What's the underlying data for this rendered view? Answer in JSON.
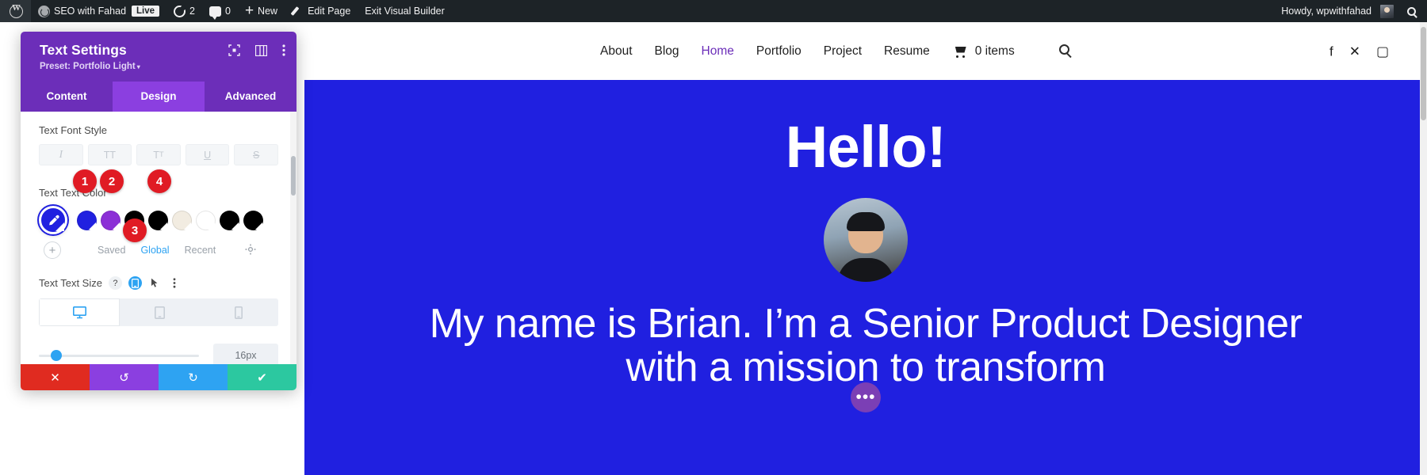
{
  "adminbar": {
    "logo_icon": "wordpress-logo-icon",
    "site_icon": "site-dashboard-icon",
    "site_name": "SEO with Fahad",
    "live_badge": "Live",
    "updates_icon": "updates-icon",
    "updates_count": "2",
    "comments_icon": "comments-icon",
    "comments_count": "0",
    "new_icon": "plus-icon",
    "new_label": "New",
    "edit_icon": "pencil-icon",
    "edit_label": "Edit Page",
    "exit_label": "Exit Visual Builder",
    "howdy": "Howdy, wpwithfahad",
    "avatar_icon": "user-avatar",
    "search_icon": "search-icon"
  },
  "site_header": {
    "nav": [
      {
        "label": "About",
        "active": false
      },
      {
        "label": "Blog",
        "active": false
      },
      {
        "label": "Home",
        "active": true
      },
      {
        "label": "Portfolio",
        "active": false
      },
      {
        "label": "Project",
        "active": false
      },
      {
        "label": "Resume",
        "active": false
      }
    ],
    "cart_icon": "shopping-cart-icon",
    "cart_label": "0 items",
    "search_icon": "search-icon",
    "social": [
      {
        "icon": "facebook-icon",
        "glyph": "f"
      },
      {
        "icon": "x-twitter-icon",
        "glyph": "✕"
      },
      {
        "icon": "instagram-icon",
        "glyph": "▢"
      }
    ]
  },
  "hero": {
    "background_color": "#2020e0",
    "heading": "Hello!",
    "avatar_icon": "profile-photo",
    "tagline": "My name is Brian. I’m a Senior Product Designer with a mission to transform",
    "more_button_icon": "ellipsis-icon",
    "more_button_label": "•••"
  },
  "modal": {
    "title": "Text Settings",
    "preset_label": "Preset: Portfolio Light",
    "preset_caret": "▾",
    "header_icons": [
      {
        "name": "focus-target-icon"
      },
      {
        "name": "layout-columns-icon"
      },
      {
        "name": "more-vertical-icon"
      }
    ],
    "tabs": [
      {
        "label": "Content",
        "active": false
      },
      {
        "label": "Design",
        "active": true
      },
      {
        "label": "Advanced",
        "active": false
      }
    ],
    "font_style": {
      "label": "Text Font Style",
      "buttons": [
        {
          "name": "italic-button",
          "glyph": "I"
        },
        {
          "name": "uppercase-button",
          "glyph": "TT"
        },
        {
          "name": "capitalize-button",
          "glyph": "T"
        },
        {
          "name": "underline-button",
          "glyph": "U"
        },
        {
          "name": "strikethrough-button",
          "glyph": "S"
        }
      ]
    },
    "text_color": {
      "label": "Text Text Color",
      "eyedropper_icon": "eyedropper-icon",
      "eyedropper_color": "#2020e0",
      "swatches": [
        {
          "name": "swatch-blue",
          "color": "#2020e0"
        },
        {
          "name": "swatch-purple",
          "color": "#8b2fd6"
        },
        {
          "name": "swatch-black-1",
          "color": "#000000"
        },
        {
          "name": "swatch-black-2",
          "color": "#000000"
        },
        {
          "name": "swatch-cream",
          "color": "#f2ece1"
        },
        {
          "name": "swatch-white",
          "color": "#ffffff"
        },
        {
          "name": "swatch-black-3",
          "color": "#000000"
        },
        {
          "name": "swatch-black-4",
          "color": "#000000"
        }
      ],
      "add_swatch_glyph": "+",
      "palette_tabs": [
        {
          "label": "Saved",
          "active": false
        },
        {
          "label": "Global",
          "active": true
        },
        {
          "label": "Recent",
          "active": false
        }
      ],
      "gear_icon": "gear-icon"
    },
    "text_size": {
      "label": "Text Text Size",
      "help_icon": "help-icon",
      "help_glyph": "?",
      "responsive_icon": "responsive-mobile-icon",
      "hover_icon": "cursor-hover-icon",
      "options_icon": "more-vertical-icon",
      "devices": [
        {
          "name": "desktop-tab",
          "icon": "desktop-icon",
          "active": true
        },
        {
          "name": "tablet-tab",
          "icon": "tablet-icon",
          "active": false
        },
        {
          "name": "phone-tab",
          "icon": "phone-icon",
          "active": false
        }
      ],
      "slider_percent": 11,
      "value": "16px"
    },
    "actions": [
      {
        "name": "cancel-button",
        "icon": "close-icon",
        "glyph": "✕",
        "color": "#e02b20"
      },
      {
        "name": "undo-button",
        "icon": "undo-icon",
        "glyph": "↺",
        "color": "#8b3fe0"
      },
      {
        "name": "redo-button",
        "icon": "redo-icon",
        "glyph": "↻",
        "color": "#2ea3f2"
      },
      {
        "name": "save-button",
        "icon": "check-icon",
        "glyph": "✔",
        "color": "#2cc8a0"
      }
    ]
  },
  "badges": [
    {
      "id": "b1",
      "label": "1"
    },
    {
      "id": "b2",
      "label": "2"
    },
    {
      "id": "b3",
      "label": "3"
    },
    {
      "id": "b4",
      "label": "4"
    }
  ]
}
